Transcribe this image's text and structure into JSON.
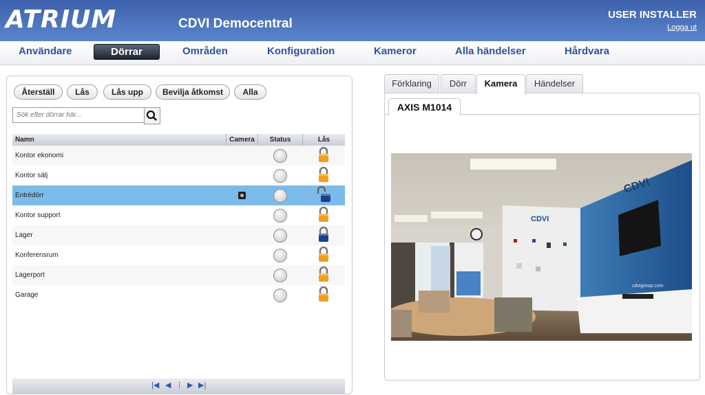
{
  "header": {
    "logo": "ATRIUM",
    "title": "CDVI Democentral",
    "user": "USER INSTALLER",
    "logout": "Logga ut"
  },
  "nav": [
    "Användare",
    "Dörrar",
    "Områden",
    "Konfiguration",
    "Kameror",
    "Alla händelser",
    "Hårdvara"
  ],
  "nav_active": "Dörrar",
  "toolbar": {
    "reset": "Återställ",
    "lock": "Lås",
    "unlock": "Lås upp",
    "grant": "Bevilja åtkomst",
    "all": "Alla"
  },
  "search": {
    "placeholder": "Sök efter dörrar här..."
  },
  "table": {
    "columns": [
      "Namn",
      "Camera",
      "Status",
      "Lås"
    ],
    "rows": [
      {
        "name": "Kontor ekonomi",
        "camera": false,
        "lock": "locked"
      },
      {
        "name": "Kontor sälj",
        "camera": false,
        "lock": "locked"
      },
      {
        "name": "Entrédörr",
        "camera": true,
        "lock": "unlocked"
      },
      {
        "name": "Kontor support",
        "camera": false,
        "lock": "locked"
      },
      {
        "name": "Lager",
        "camera": false,
        "lock": "locked-blue"
      },
      {
        "name": "Konferensrum",
        "camera": false,
        "lock": "locked"
      },
      {
        "name": "Lagerport",
        "camera": false,
        "lock": "locked"
      },
      {
        "name": "Garage",
        "camera": false,
        "lock": "locked"
      }
    ],
    "selected_row": 2
  },
  "tabs": [
    "Förklaring",
    "Dörr",
    "Kamera",
    "Händelser"
  ],
  "tab_active": "Kamera",
  "camera": {
    "name": "AXIS M1014",
    "wall_logo": "CDVI",
    "url_text": "cdvigroup.com"
  },
  "colors": {
    "header": "#4a73bd",
    "nav_text": "#2f53a0",
    "selected_row": "#7cbbe9",
    "lock_gold": "#f0a020",
    "lock_blue": "#1c3f8f"
  }
}
